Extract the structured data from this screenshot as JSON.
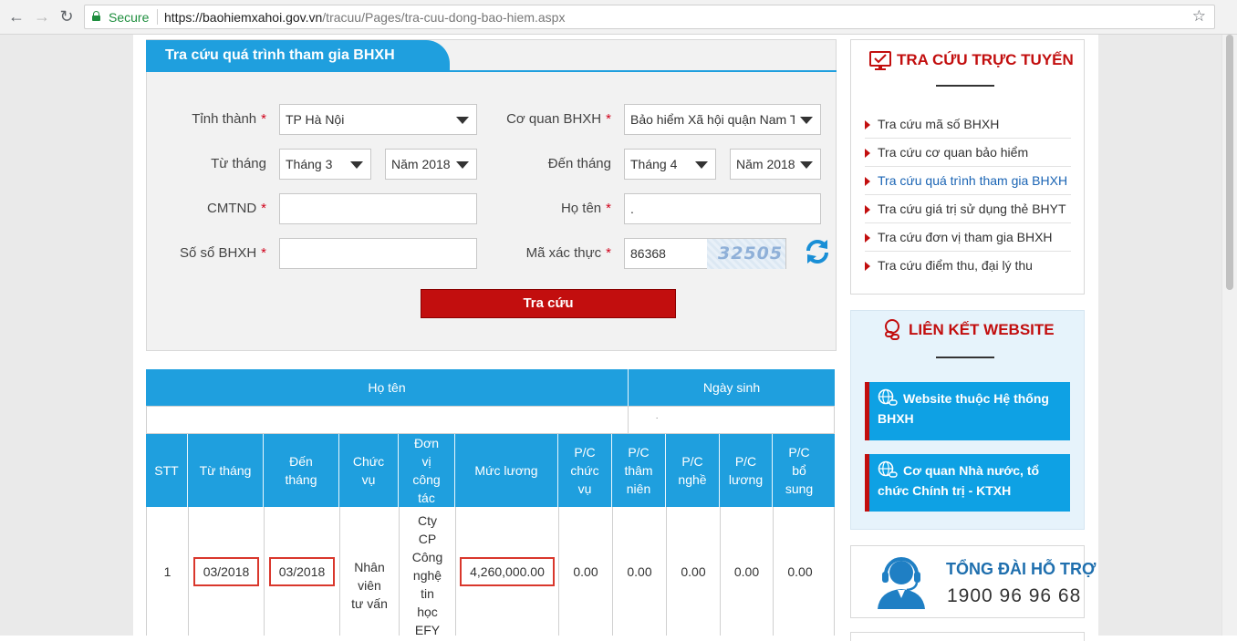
{
  "browser": {
    "secure_label": "Secure",
    "url_host": "https://baohiemxahoi.gov.vn",
    "url_path": "/tracuu/Pages/tra-cuu-dong-bao-hiem.aspx"
  },
  "form": {
    "title": "Tra cứu quá trình tham gia BHXH",
    "province_label": "Tỉnh thành",
    "province_value": "TP Hà Nội",
    "agency_label": "Cơ quan BHXH",
    "agency_value": "Bảo hiểm Xã hội quận Nam Từ",
    "from_label": "Từ tháng",
    "from_month": "Tháng 3",
    "from_year": "Năm 2018",
    "to_label": "Đến tháng",
    "to_month": "Tháng 4",
    "to_year": "Năm 2018",
    "id_label": "CMTND",
    "id_value": "",
    "name_label": "Họ tên",
    "name_value": ".",
    "book_label": "Số sổ BHXH",
    "book_value": "",
    "captcha_label": "Mã xác thực",
    "captcha_value": "86368",
    "captcha_image_text": "32505",
    "required_mark": "*",
    "submit_label": "Tra cứu"
  },
  "person_table": {
    "headers": [
      "Họ tên",
      "Ngày sinh"
    ],
    "row": [
      "",
      "."
    ]
  },
  "history_table": {
    "headers": [
      "STT",
      "Từ tháng",
      "Đến tháng",
      "Chức vụ",
      "Đơn vị công tác",
      "Mức lương",
      "P/C chức vụ",
      "P/C thâm niên",
      "P/C nghề",
      "P/C lương",
      "P/C bổ sung"
    ],
    "rows": [
      {
        "stt": "1",
        "from": "03/2018",
        "to": "03/2018",
        "position": "Nhân viên tư vấn",
        "unit": "Cty CP Công nghệ tin học EFY",
        "salary": "4,260,000.00",
        "pc_position": "0.00",
        "pc_seniority": "0.00",
        "pc_job": "0.00",
        "pc_salary": "0.00",
        "pc_extra": "0.00"
      }
    ]
  },
  "sidebar": {
    "lookup_title": "TRA CỨU TRỰC TUYẾN",
    "lookup_items": [
      "Tra cứu mã số BHXH",
      "Tra cứu cơ quan bảo hiểm",
      "Tra cứu quá trình tham gia BHXH",
      "Tra cứu giá trị sử dụng thẻ BHYT",
      "Tra cứu đơn vị tham gia BHXH",
      "Tra cứu điểm thu, đại lý thu"
    ],
    "active_index": 2,
    "links_title": "LIÊN KẾT WEBSITE",
    "link_buttons": [
      "Website thuộc Hệ thống BHXH",
      "Cơ quan Nhà nước, tổ chức Chính trị - KTXH"
    ],
    "hotline_title": "TỔNG ĐÀI HỖ TRỢ",
    "hotline_number": "1900 96 96 68"
  },
  "colors": {
    "accent_blue": "#1f9fde",
    "accent_red": "#c20e0e",
    "highlight_red": "#d9372c"
  },
  "icons": [
    "back-icon",
    "forward-icon",
    "reload-icon",
    "lock-icon",
    "star-icon",
    "refresh-captcha-icon",
    "monitor-icon",
    "chain-link-icon",
    "globe-icon",
    "headset-icon"
  ]
}
